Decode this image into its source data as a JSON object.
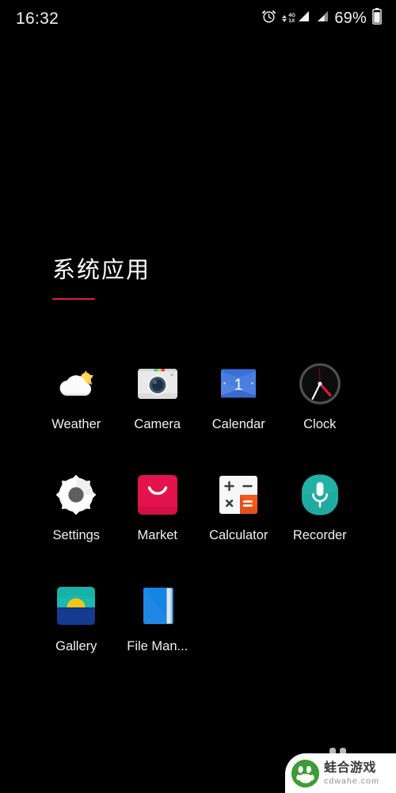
{
  "status_bar": {
    "time": "16:32",
    "battery_percent": "69%",
    "network_label_top": "4G",
    "network_label_bottom": "1X",
    "icons": [
      "alarm-icon",
      "data-arrows-icon",
      "signal-4g-icon",
      "signal-bars-icon",
      "battery-icon"
    ]
  },
  "section": {
    "title": "系统应用"
  },
  "apps": [
    {
      "label": "Weather",
      "icon": "weather-icon",
      "name": "app-weather"
    },
    {
      "label": "Camera",
      "icon": "camera-icon",
      "name": "app-camera"
    },
    {
      "label": "Calendar",
      "icon": "calendar-icon",
      "name": "app-calendar",
      "badge": "1"
    },
    {
      "label": "Clock",
      "icon": "clock-icon",
      "name": "app-clock"
    },
    {
      "label": "Settings",
      "icon": "settings-icon",
      "name": "app-settings"
    },
    {
      "label": "Market",
      "icon": "market-icon",
      "name": "app-market"
    },
    {
      "label": "Calculator",
      "icon": "calculator-icon",
      "name": "app-calculator",
      "glyphs": [
        "+",
        "−",
        "×",
        "="
      ]
    },
    {
      "label": "Recorder",
      "icon": "recorder-icon",
      "name": "app-recorder"
    },
    {
      "label": "Gallery",
      "icon": "gallery-icon",
      "name": "app-gallery"
    },
    {
      "label": "File Man...",
      "icon": "file-manager-icon",
      "name": "app-file-manager"
    }
  ],
  "watermark": {
    "cn": "蛙合游戏",
    "en": "cdwahe.com"
  },
  "colors": {
    "background": "#000000",
    "accent_rule": "#e0203c",
    "text_primary": "#ffffff",
    "market_red": "#e3134d",
    "calendar_blue": "#3a6fd8",
    "recorder_teal": "#23b0a5",
    "calculator_orange": "#f4591d",
    "gallery_teal": "#19b9ad",
    "gallery_sun": "#f5c518",
    "gallery_sea": "#143b8f",
    "file_blue": "#1684e3",
    "watermark_green": "#3d9c35"
  }
}
